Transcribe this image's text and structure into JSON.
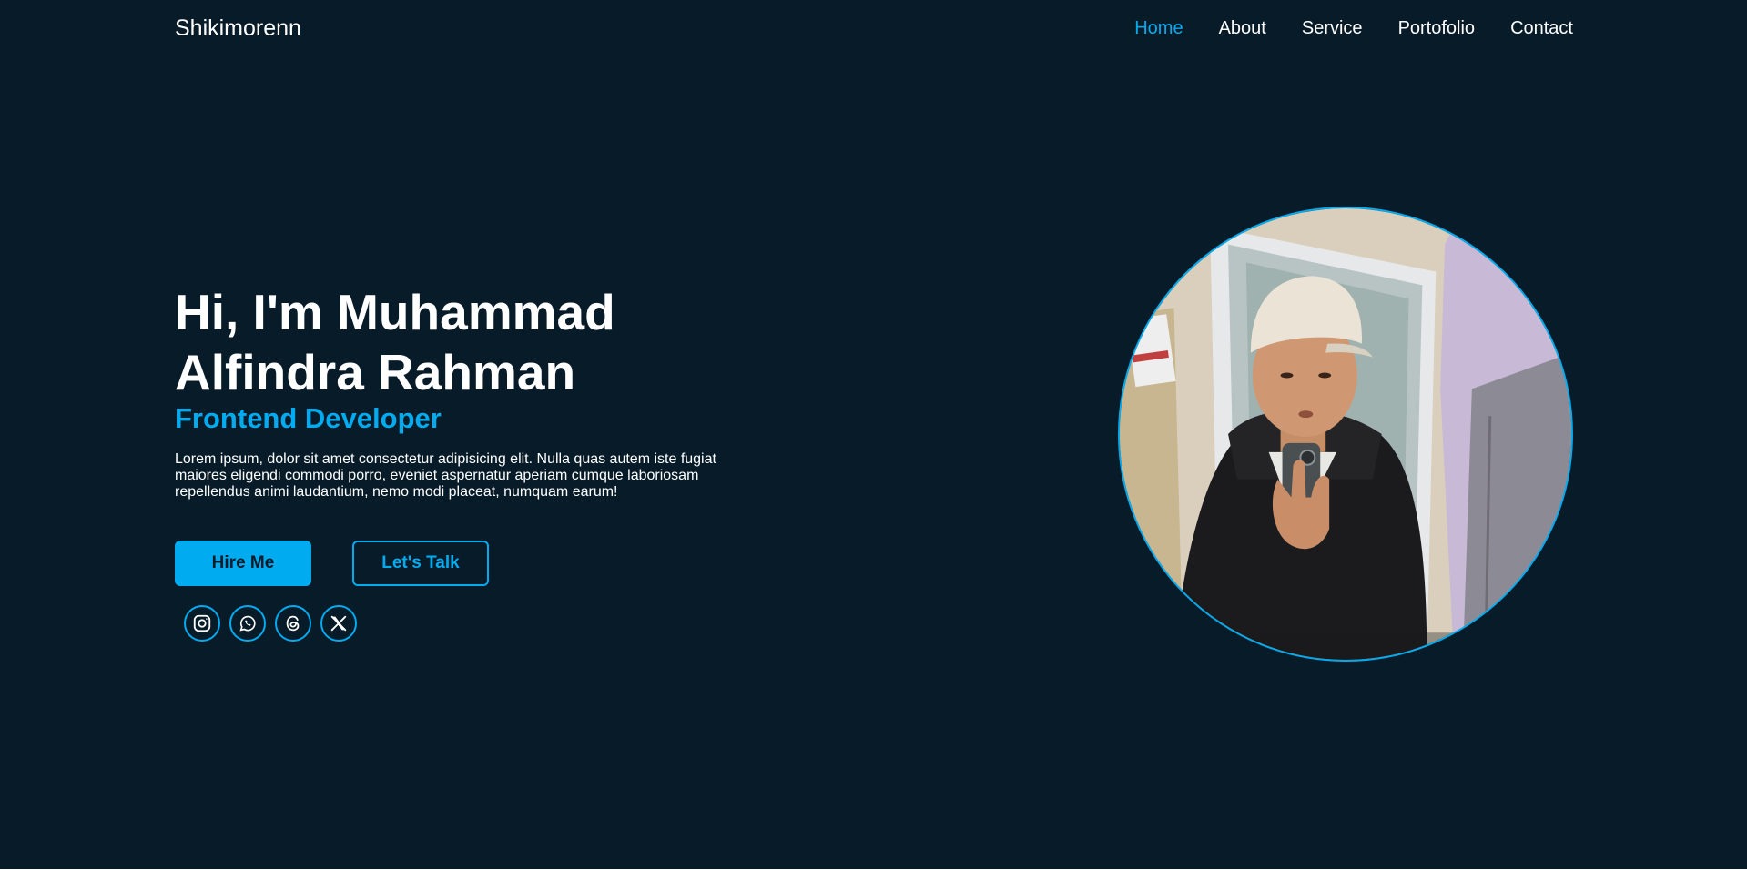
{
  "header": {
    "logo": "Shikimorenn",
    "nav": [
      {
        "label": "Home",
        "active": true
      },
      {
        "label": "About",
        "active": false
      },
      {
        "label": "Service",
        "active": false
      },
      {
        "label": "Portofolio",
        "active": false
      },
      {
        "label": "Contact",
        "active": false
      }
    ]
  },
  "hero": {
    "heading": "Hi, I'm Muhammad Alfindra Rahman",
    "subheading": "Frontend Developer",
    "description": "Lorem ipsum, dolor sit amet consectetur adipisicing elit. Nulla quas autem iste fugiat maiores eligendi commodi porro, eveniet aspernatur aperiam cumque laboriosam repellendus animi laudantium, nemo modi placeat, numquam earum!",
    "buttons": {
      "primary": "Hire Me",
      "secondary": "Let's Talk"
    },
    "social": [
      {
        "icon": "instagram-icon"
      },
      {
        "icon": "whatsapp-icon"
      },
      {
        "icon": "threads-icon"
      },
      {
        "icon": "x-twitter-icon"
      }
    ]
  },
  "profile_image": {
    "icon": "profile-photo"
  },
  "colors": {
    "background": "#081b29",
    "accent": "#00abf0",
    "text": "#ffffff"
  }
}
